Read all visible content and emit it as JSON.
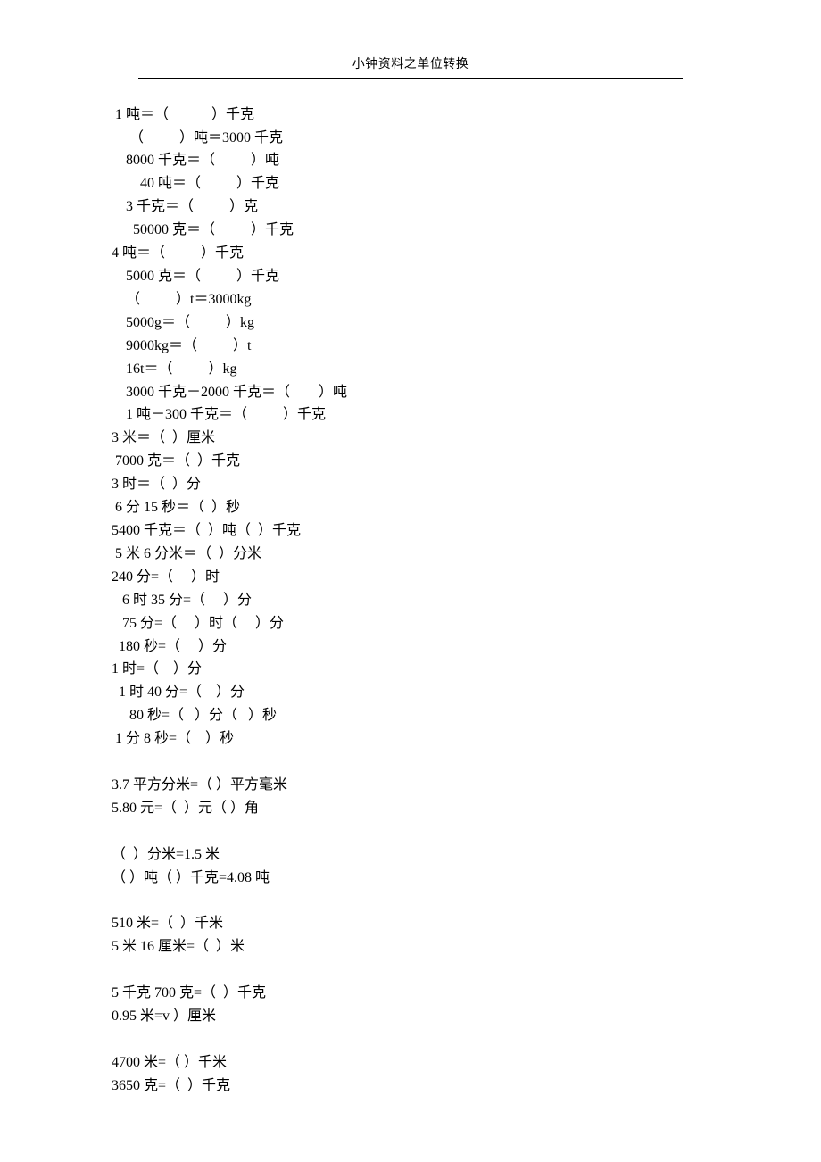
{
  "header": {
    "title": "小钟资料之单位转换"
  },
  "lines": [
    " 1 吨＝（            ）千克",
    "     （          ）吨＝3000 千克",
    "    8000 千克＝（          ）吨",
    "        40 吨＝（          ）千克",
    "    3 千克＝（          ）克",
    "      50000 克＝（          ）千克",
    "4 吨＝（          ）千克",
    "    5000 克＝（          ）千克",
    "    （          ）t＝3000kg",
    "    5000g＝（          ）kg",
    "    9000kg＝（          ）t",
    "    16t＝（          ）kg",
    "    3000 千克－2000 千克＝（        ）吨",
    "    1 吨－300 千克＝（          ）千克",
    "3 米＝（  ）厘米",
    " 7000 克＝（  ）千克",
    "3 时＝（  ）分",
    " 6 分 15 秒＝（  ）秒",
    "5400 千克＝（  ）吨（  ）千克",
    " 5 米 6 分米＝（  ）分米",
    "240 分=（     ）时",
    "   6 时 35 分=（     ）分",
    "   75 分=（     ）时（     ）分",
    "  180 秒=（     ）分",
    "1 时=（    ）分",
    "  1 时 40 分=（    ）分",
    "     80 秒=（   ）分（   ）秒",
    " 1 分 8 秒=（    ）秒",
    "",
    "3.7 平方分米=（ ）平方毫米",
    "5.80 元=（  ）元（ ）角",
    "",
    "（  ）分米=1.5 米",
    "（ ）吨（ ）千克=4.08 吨",
    "",
    "510 米=（  ）千米",
    "5 米 16 厘米=（  ）米",
    "",
    "5 千克 700 克=（  ）千克",
    "0.95 米=v ）厘米",
    "",
    "4700 米=（ ）千米",
    "3650 克=（  ）千克"
  ]
}
